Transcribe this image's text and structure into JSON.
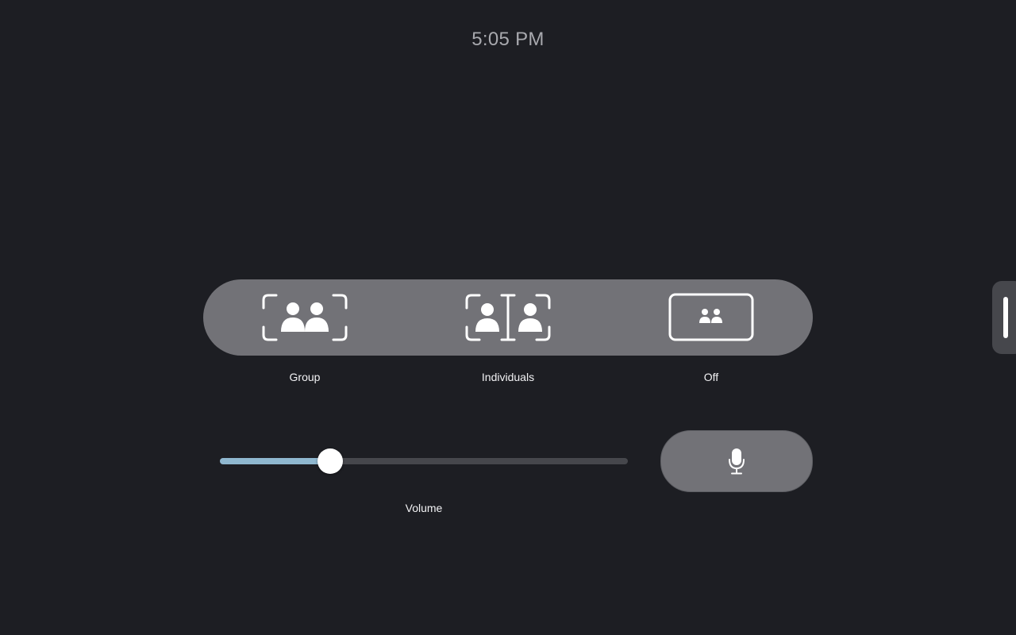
{
  "clock": {
    "time": "5:05 PM"
  },
  "framing_modes": [
    {
      "id": "group",
      "label": "Group",
      "icon": "group-framing-icon"
    },
    {
      "id": "individuals",
      "label": "Individuals",
      "icon": "individuals-framing-icon"
    },
    {
      "id": "off",
      "label": "Off",
      "icon": "framing-off-icon"
    }
  ],
  "volume": {
    "label": "Volume",
    "level_percent": 27
  },
  "mic": {
    "icon": "microphone-icon"
  },
  "side_panel": {
    "icon": "drag-handle-icon"
  },
  "colors": {
    "background": "#1d1e23",
    "bar": "#727277",
    "slider_fill": "#8fb7cf",
    "slider_track": "#46474c"
  }
}
